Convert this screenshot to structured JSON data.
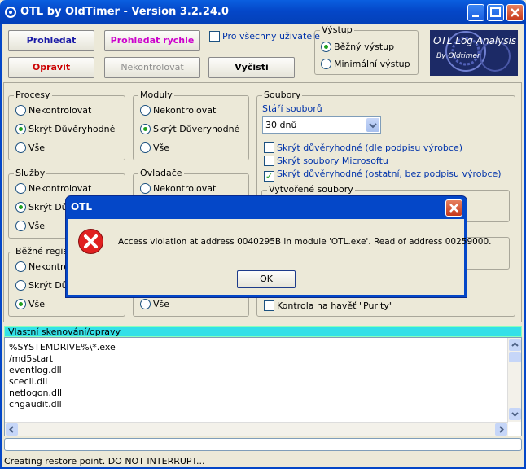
{
  "window": {
    "title": "OTL by OldTimer - Version 3.2.24.0"
  },
  "buttons": {
    "prohledat": "Prohledat",
    "prohledat_rychle": "Prohledat rychle",
    "opravit": "Opravit",
    "nekontrolovat": "Nekontrolovat",
    "vycisti": "Vyčisti"
  },
  "colors": {
    "prohledat": "#1a1aa6",
    "prohledat_rychle": "#cc00cc",
    "opravit": "#cc0000",
    "disabled": "#8e8e8e",
    "memo_header_bg": "#33e0e8"
  },
  "all_users_label": "Pro všechny uživatele",
  "vystup": {
    "label": "Výstup",
    "options": [
      "Běžný výstup",
      "Minimální výstup"
    ]
  },
  "logo": {
    "line1": "OTL Log Analysis",
    "line2": "By Oldtimer"
  },
  "groups": {
    "procesy": {
      "label": "Procesy",
      "options": [
        "Nekontrolovat",
        "Skrýt Důvěryhodné",
        "Vše"
      ]
    },
    "moduly": {
      "label": "Moduly",
      "options": [
        "Nekontrolovat",
        "Skrýt Důveryhodné",
        "Vše"
      ]
    },
    "sluzby": {
      "label": "Služby",
      "options": [
        "Nekontrolovat",
        "Skrýt Dův",
        "Vše"
      ]
    },
    "ovladace": {
      "label": "Ovladače",
      "options": [
        "Nekontrolovat"
      ]
    },
    "bezne": {
      "label": "Běžné regist",
      "options": [
        "Nekontrol",
        "Skrýt Dův",
        "Vše"
      ]
    },
    "bezne_right_opt": "Vše"
  },
  "soubory": {
    "label": "Soubory",
    "stari_label": "Stáří souborů",
    "stari_value": "30 dnů",
    "checks": [
      "Skrýt důvěryhodné (dle podpisu výrobce)",
      "Skrýt soubory Microsoftu",
      "Skrýt důvěryhodné (ostatní, bez podpisu výrobce)"
    ],
    "vytvorene_label": "Vytvořené soubory",
    "purity_label": "Kontrola na havěť \"Purity\""
  },
  "dialog": {
    "title": "OTL",
    "message": "Access violation at address 0040295B in module 'OTL.exe'. Read of address 00259000.",
    "ok": "OK",
    "icon": "error-icon"
  },
  "memo": {
    "header": "Vlastní skenování/opravy",
    "lines": [
      "%SYSTEMDRIVE%\\*.exe",
      "/md5start",
      "eventlog.dll",
      "scecli.dll",
      "netlogon.dll",
      "cngaudit.dll"
    ]
  },
  "status": "Creating restore point. DO NOT INTERRUPT..."
}
